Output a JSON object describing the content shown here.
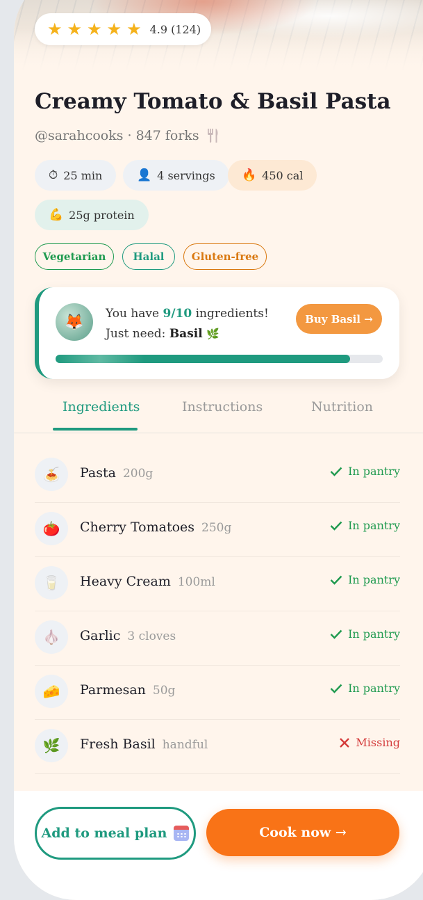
{
  "rating": {
    "stars": 5,
    "text": "4.9 (124)"
  },
  "recipe": {
    "title": "Creamy Tomato & Basil Pasta",
    "author": "@sarahcooks",
    "separator": "·",
    "forks": "847 forks"
  },
  "chips": [
    {
      "icon": "⏱",
      "label": "25 min",
      "bg": "#eef1f5"
    },
    {
      "icon": "👤",
      "label": "4 servings",
      "bg": "#eef1f5"
    },
    {
      "icon": "🔥",
      "label": "450 cal",
      "bg": "#fde9d4"
    },
    {
      "icon": "💪",
      "label": "25g protein",
      "bg": "#e2f1ec"
    }
  ],
  "tags": [
    {
      "label": "Vegetarian",
      "color": "#1f9a4f"
    },
    {
      "label": "Halal",
      "color": "#1f9a7f"
    },
    {
      "label": "Gluten-free",
      "color": "#d9780f"
    }
  ],
  "pantry_card": {
    "avatar": "🦊",
    "msg_prefix": "You have ",
    "count": "9/10",
    "msg_mid": " ingredients! Just need: ",
    "missing": "Basil",
    "missing_icon": "🌿",
    "buy_label": "Buy Basil →",
    "progress": 0.9
  },
  "tabs": [
    {
      "label": "Ingredients",
      "active": true
    },
    {
      "label": "Instructions",
      "active": false
    },
    {
      "label": "Nutrition",
      "active": false
    }
  ],
  "ingredients": [
    {
      "icon": "🍝",
      "name": "Pasta",
      "qty": "200g",
      "status": "In pantry",
      "ok": true
    },
    {
      "icon": "🍅",
      "name": "Cherry Tomatoes",
      "qty": "250g",
      "status": "In pantry",
      "ok": true
    },
    {
      "icon": "🥛",
      "name": "Heavy Cream",
      "qty": "100ml",
      "status": "In pantry",
      "ok": true
    },
    {
      "icon": "🧄",
      "name": "Garlic",
      "qty": "3 cloves",
      "status": "In pantry",
      "ok": true
    },
    {
      "icon": "🧀",
      "name": "Parmesan",
      "qty": "50g",
      "status": "In pantry",
      "ok": true
    },
    {
      "icon": "🌿",
      "name": "Fresh Basil",
      "qty": "handful",
      "status": "Missing",
      "ok": false
    }
  ],
  "actions": {
    "meal_plan": "Add to meal plan",
    "cook_now": "Cook now →"
  }
}
